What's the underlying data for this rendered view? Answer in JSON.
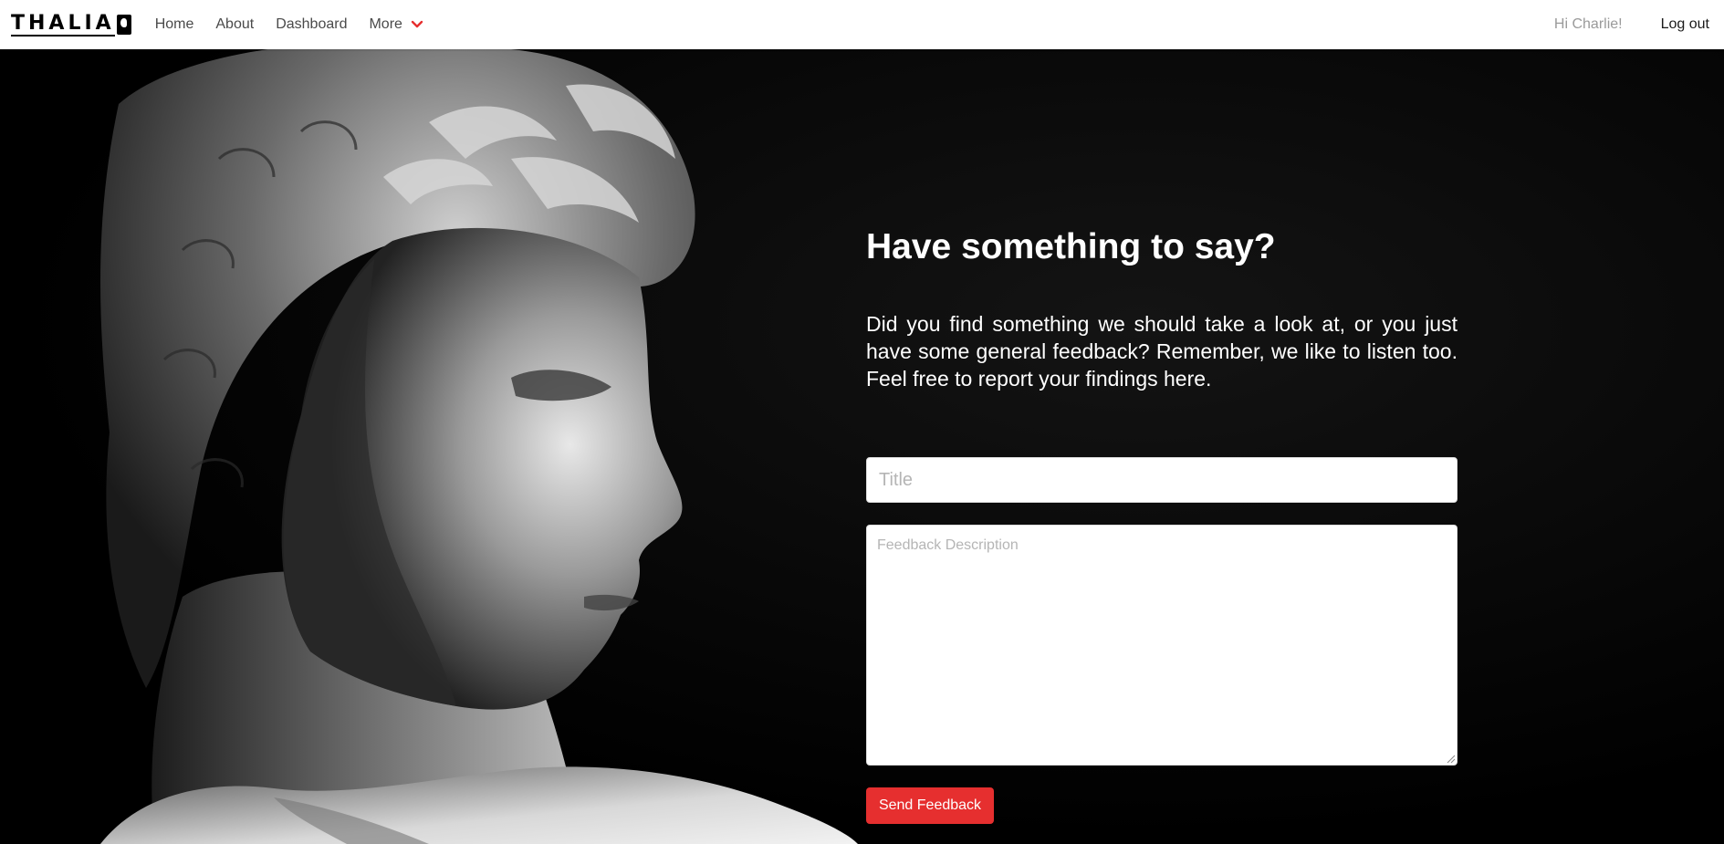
{
  "navbar": {
    "logo_text": "THALIA",
    "links": [
      {
        "label": "Home"
      },
      {
        "label": "About"
      },
      {
        "label": "Dashboard"
      }
    ],
    "more_label": "More",
    "greeting": "Hi Charlie!",
    "logout_label": "Log out"
  },
  "feedback": {
    "heading": "Have something to say?",
    "intro": "Did you find something we should take a look at, or you just have some general feedback? Remember, we like to listen too. Feel free to report your findings here.",
    "title_placeholder": "Title",
    "description_placeholder": "Feedback Description",
    "submit_label": "Send Feedback"
  },
  "colors": {
    "accent": "#e62f2f",
    "background": "#000000",
    "navbar": "#ffffff"
  }
}
